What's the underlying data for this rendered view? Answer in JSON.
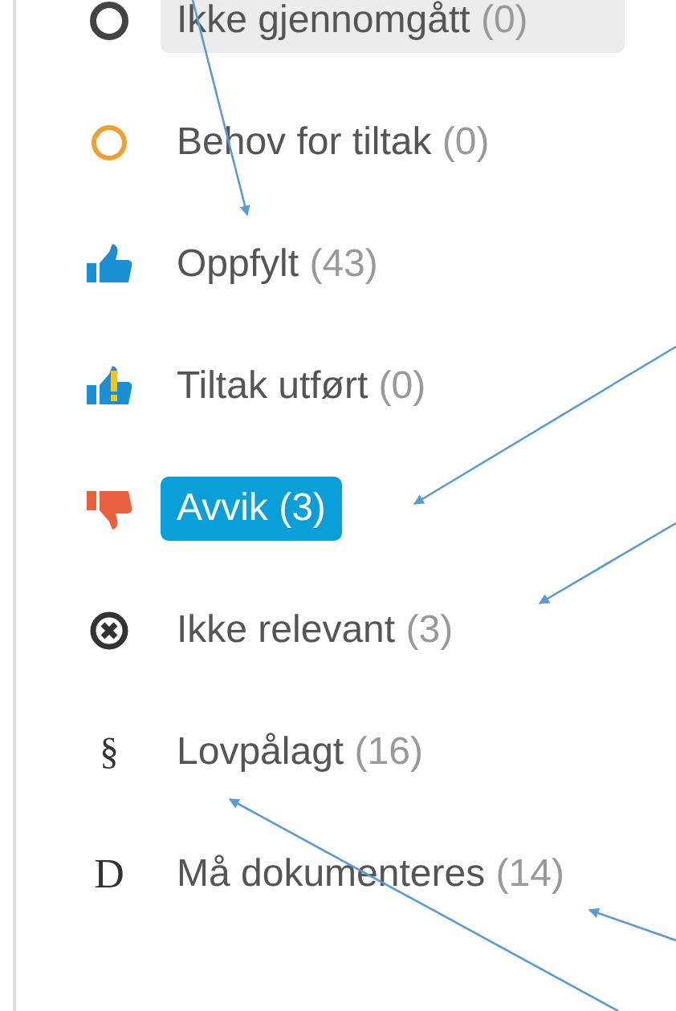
{
  "statuses": [
    {
      "kind": "pending",
      "label": "Ikke gjennomgått",
      "count": "(0)",
      "selected": false,
      "highlighted": true
    },
    {
      "kind": "ring",
      "label": "Behov for tiltak",
      "count": "(0)",
      "selected": false,
      "highlighted": false
    },
    {
      "kind": "thumbs-up",
      "label": "Oppfylt",
      "count": "(43)",
      "selected": false,
      "highlighted": false
    },
    {
      "kind": "thumbs-up-alert",
      "label": "Tiltak utført",
      "count": "(0)",
      "selected": false,
      "highlighted": false
    },
    {
      "kind": "thumbs-down",
      "label": "Avvik",
      "count": "(3)",
      "selected": true,
      "highlighted": false
    },
    {
      "kind": "excluded",
      "label": "Ikke relevant",
      "count": "(3)",
      "selected": false,
      "highlighted": false
    },
    {
      "kind": "symbol",
      "symbol": "§",
      "label": "Lovpålagt",
      "count": "(16)",
      "selected": false,
      "highlighted": false
    },
    {
      "kind": "letter",
      "symbol": "D",
      "label": "Må dokumenteres",
      "count": "(14)",
      "selected": false,
      "highlighted": false
    }
  ]
}
